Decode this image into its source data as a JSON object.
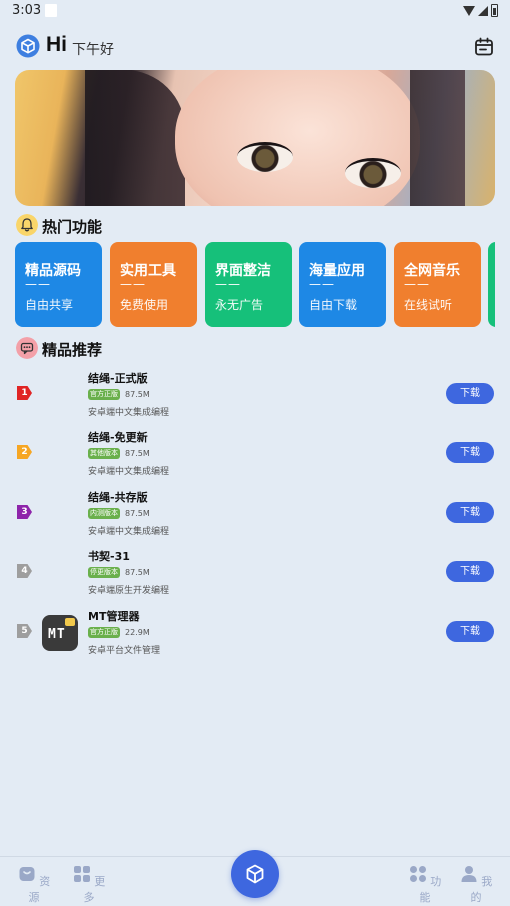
{
  "status_bar": {
    "time": "3:03"
  },
  "header": {
    "hi": "Hi",
    "greeting": "下午好"
  },
  "hot": {
    "title": "热门功能",
    "cards": [
      {
        "title": "精品源码",
        "dash": "——",
        "sub": "自由共享",
        "color": "#1e88e5"
      },
      {
        "title": "实用工具",
        "dash": "——",
        "sub": "免费使用",
        "color": "#f07f2e"
      },
      {
        "title": "界面整洁",
        "dash": "——",
        "sub": "永无广告",
        "color": "#16c07a"
      },
      {
        "title": "海量应用",
        "dash": "——",
        "sub": "自由下载",
        "color": "#1e88e5"
      },
      {
        "title": "全网音乐",
        "dash": "——",
        "sub": "在线试听",
        "color": "#f07f2e"
      }
    ]
  },
  "recommend": {
    "title": "精品推荐",
    "items": [
      {
        "rank": "1",
        "name": "结绳-正式版",
        "tag": "官方正版",
        "size": "87.5M",
        "desc": "安卓端中文集成编程",
        "rank_color": "#e02424"
      },
      {
        "rank": "2",
        "name": "结绳-免更新",
        "tag": "其他版本",
        "size": "87.5M",
        "desc": "安卓端中文集成编程",
        "rank_color": "#f6a623"
      },
      {
        "rank": "3",
        "name": "结绳-共存版",
        "tag": "内测版本",
        "size": "87.5M",
        "desc": "安卓端中文集成编程",
        "rank_color": "#8e24aa"
      },
      {
        "rank": "4",
        "name": "书契-31",
        "tag": "停更版本",
        "size": "87.5M",
        "desc": "安卓端原生开发编程",
        "rank_color": "#9e9e9e"
      },
      {
        "rank": "5",
        "name": "MT管理器",
        "tag": "官方正版",
        "size": "22.9M",
        "desc": "安卓平台文件管理",
        "rank_color": "#9e9e9e",
        "icon_text": "MT"
      }
    ],
    "download_label": "下载"
  },
  "bottom_nav": {
    "resources": "资源",
    "more": "更多",
    "functions": "功能",
    "mine": "我的"
  },
  "colors": {
    "accent": "#3e67df",
    "tag_green": "#6ab04c",
    "nav_inactive": "#9aa8c7"
  }
}
